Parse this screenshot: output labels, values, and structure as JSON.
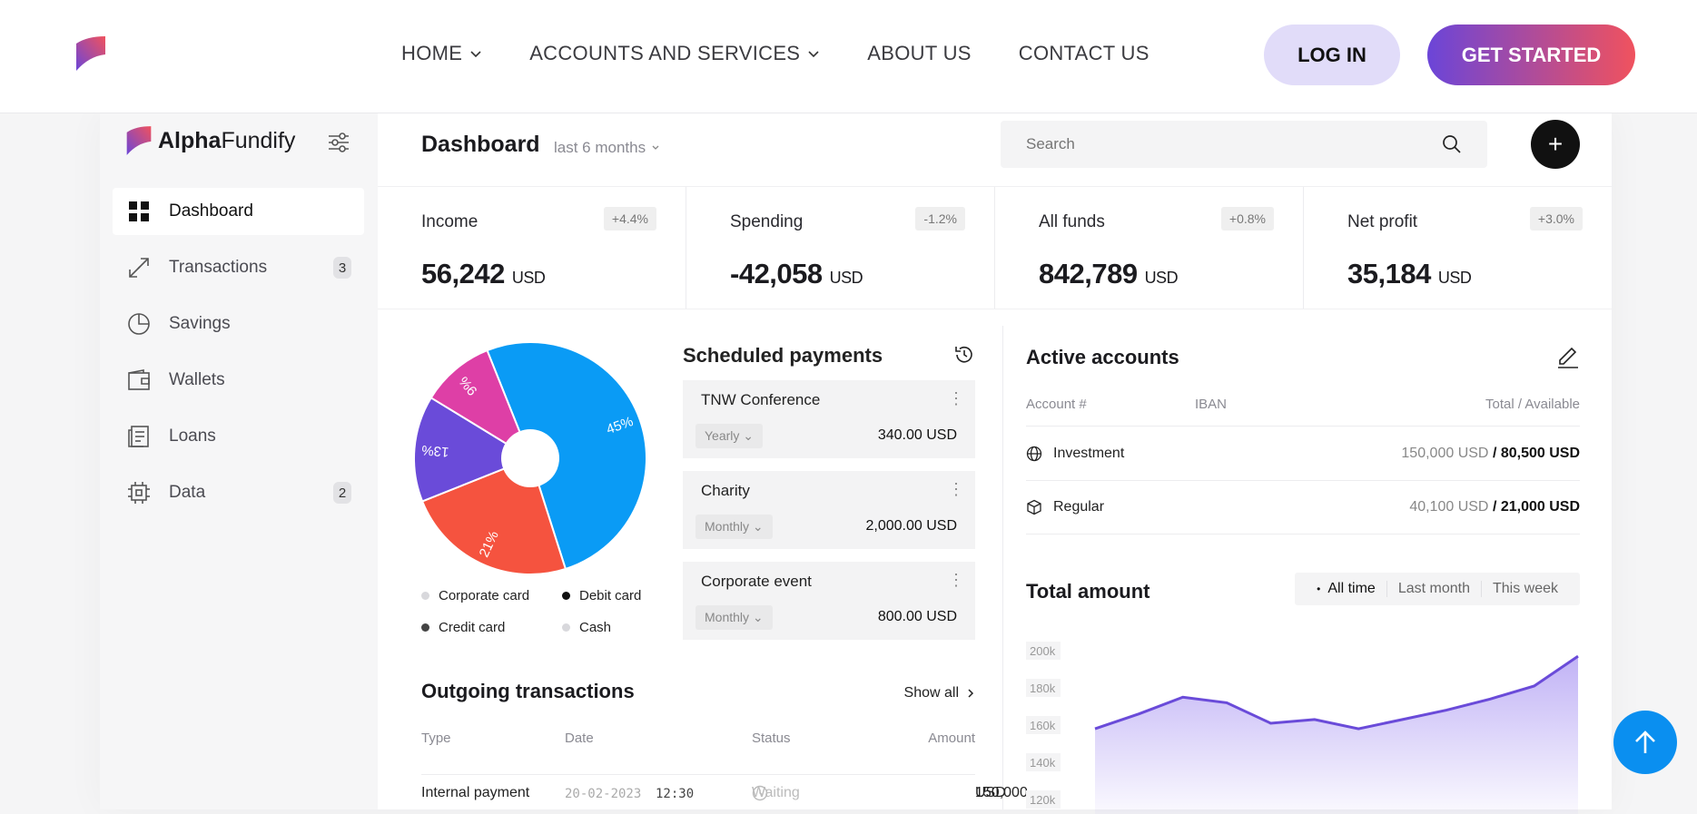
{
  "topnav": {
    "menu": [
      {
        "label": "HOME",
        "has_dropdown": true
      },
      {
        "label": "ACCOUNTS AND SERVICES",
        "has_dropdown": true
      },
      {
        "label": "ABOUT US",
        "has_dropdown": false
      },
      {
        "label": "CONTACT US",
        "has_dropdown": false
      }
    ],
    "login_label": "LOG IN",
    "start_label": "GET STARTED"
  },
  "sidebar": {
    "brand_bold": "Alpha",
    "brand_light": "Fundify",
    "items": [
      {
        "label": "Dashboard",
        "icon": "grid-icon",
        "badge": ""
      },
      {
        "label": "Transactions",
        "icon": "transfer-icon",
        "badge": "3"
      },
      {
        "label": "Savings",
        "icon": "pie-icon",
        "badge": ""
      },
      {
        "label": "Wallets",
        "icon": "wallet-icon",
        "badge": ""
      },
      {
        "label": "Loans",
        "icon": "document-icon",
        "badge": ""
      },
      {
        "label": "Data",
        "icon": "chip-icon",
        "badge": "2"
      }
    ]
  },
  "header": {
    "title": "Dashboard",
    "period": "last 6 months",
    "search_placeholder": "Search"
  },
  "stats": [
    {
      "label": "Income",
      "delta": "+4.4%",
      "value": "56,242",
      "unit": "USD"
    },
    {
      "label": "Spending",
      "delta": "-1.2%",
      "value": "-42,058",
      "unit": "USD"
    },
    {
      "label": "All funds",
      "delta": "+0.8%",
      "value": "842,789",
      "unit": "USD"
    },
    {
      "label": "Net profit",
      "delta": "+3.0%",
      "value": "35,184",
      "unit": "USD"
    }
  ],
  "pie": {
    "slices": [
      {
        "label": "45%",
        "value": 45,
        "color": "#0a9bf5"
      },
      {
        "label": "21%",
        "value": 21,
        "color": "#f5533f"
      },
      {
        "label": "13%",
        "value": 13,
        "color": "#6a4bd9"
      },
      {
        "label": "9%",
        "value": 9,
        "color": "#de3fa6"
      }
    ],
    "legend": [
      {
        "label": "Corporate card",
        "color": "#d8d8dc"
      },
      {
        "label": "Debit card",
        "color": "#111111"
      },
      {
        "label": "Credit card",
        "color": "#444444"
      },
      {
        "label": "Cash",
        "color": "#d8d8dc"
      }
    ]
  },
  "scheduled": {
    "title": "Scheduled payments",
    "items": [
      {
        "name": "TNW Conference",
        "freq": "Yearly",
        "amount": "340.00 USD"
      },
      {
        "name": "Charity",
        "freq": "Monthly",
        "amount": "2,000.00 USD"
      },
      {
        "name": "Corporate event",
        "freq": "Monthly",
        "amount": "800.00 USD"
      }
    ]
  },
  "outgoing": {
    "title": "Outgoing transactions",
    "show_all": "Show all",
    "columns": [
      "Type",
      "Date",
      "Status",
      "Amount"
    ],
    "row": {
      "type": "Internal payment",
      "date": "20-02-2023",
      "time": "12:30",
      "status": "Waiting",
      "amount": "150,000",
      "unit": "USD"
    }
  },
  "accounts": {
    "title": "Active accounts",
    "columns": [
      "Account #",
      "IBAN",
      "Total / Available"
    ],
    "rows": [
      {
        "name": "Investment",
        "icon": "globe-icon",
        "total": "150,000",
        "available": "80,500",
        "unit": "USD"
      },
      {
        "name": "Regular",
        "icon": "cube-icon",
        "total": "40,100",
        "available": "21,000",
        "unit": "USD"
      }
    ]
  },
  "total_amount": {
    "title": "Total amount",
    "tabs": [
      "All time",
      "Last month",
      "This week"
    ],
    "chart_data": {
      "type": "area",
      "y_ticks": [
        "200k",
        "180k",
        "160k",
        "140k",
        "120k"
      ],
      "ylim": [
        120000,
        200000
      ],
      "values": [
        158000,
        166000,
        175000,
        172000,
        161000,
        163000,
        158000,
        163000,
        168000,
        174000,
        181000,
        197000
      ],
      "color": "#6a4bd9"
    }
  }
}
